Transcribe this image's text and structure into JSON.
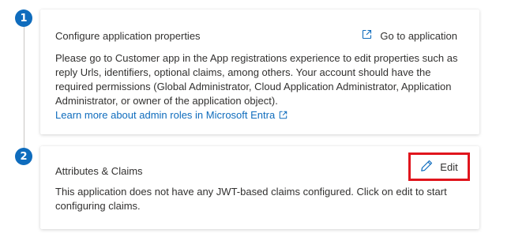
{
  "steps": [
    {
      "number": "1",
      "title": "Configure application properties",
      "action_label": "Go to application",
      "action_icon": "open-in-new-icon",
      "body": "Please go to Customer app in the App registrations experience to edit properties such as reply Urls, identifiers, optional claims, among others. Your account should have the required permissions (Global Administrator, Cloud Application Administrator, Application Administrator, or owner of the application object).",
      "link": "Learn more about admin roles in Microsoft Entra",
      "link_icon": "open-in-new-icon"
    },
    {
      "number": "2",
      "title": "Attributes & Claims",
      "action_label": "Edit",
      "action_icon": "pencil-icon",
      "body": "This application does not have any JWT-based claims configured. Click on edit to start configuring claims."
    }
  ],
  "colors": {
    "accent": "#0f6cbd",
    "highlight_border": "#e0151d",
    "text": "#323130",
    "step_line": "#c8c6c4"
  }
}
